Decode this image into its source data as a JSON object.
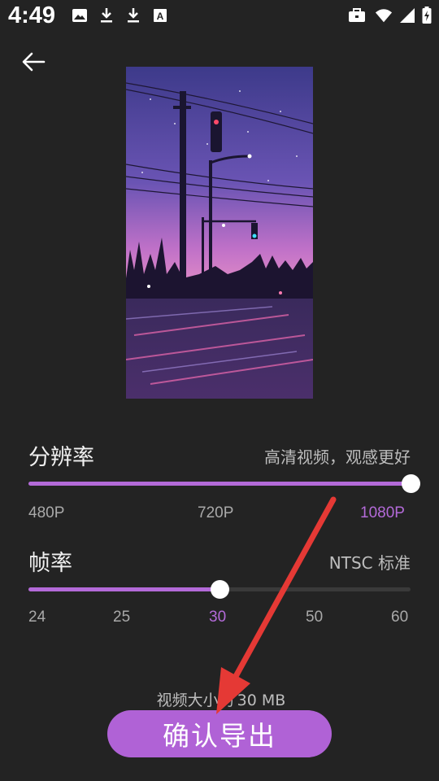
{
  "statusbar": {
    "time": "4:49",
    "icons": [
      "image-icon",
      "download-icon",
      "download-icon",
      "a-badge-icon",
      "briefcase-icon",
      "wifi-icon",
      "signal-icon",
      "battery-icon"
    ]
  },
  "header": {
    "back_icon": "arrow-left-icon"
  },
  "resolution": {
    "title": "分辨率",
    "description": "高清视频，观感更好",
    "options": [
      "480P",
      "720P",
      "1080P"
    ],
    "selected": "1080P",
    "value_fraction": 1.0
  },
  "framerate": {
    "title": "帧率",
    "description": "NTSC 标准",
    "options": [
      "24",
      "25",
      "30",
      "50",
      "60"
    ],
    "selected": "30",
    "value_fraction": 0.5
  },
  "footer": {
    "size_prefix": "视频大小约",
    "size_value": "30 MB",
    "export_label": "确认导出"
  },
  "colors": {
    "accent": "#b062d6",
    "background": "#232323",
    "annotation_arrow": "#e53935"
  }
}
